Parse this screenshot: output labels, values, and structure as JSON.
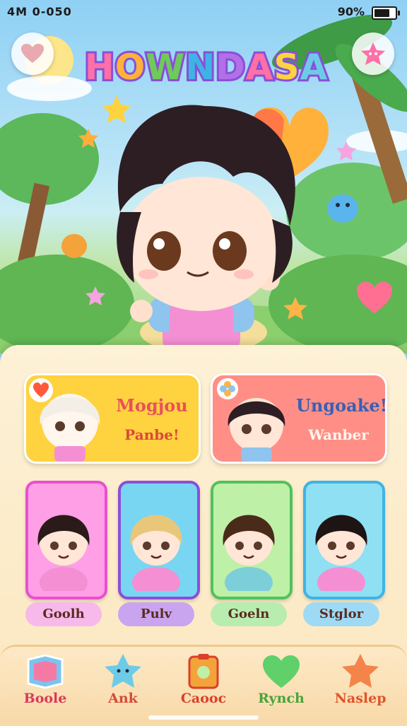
{
  "status": {
    "time": "4M 0-050",
    "battery_text": "90%",
    "battery_level": 0.8
  },
  "header": {
    "title": "HOWNDASA",
    "left_icon": "heart-icon",
    "right_icon": "star-mascot-icon"
  },
  "featured": [
    {
      "line1": "Mogjou",
      "line2": "Panbe!",
      "color": "#ffd23f",
      "badge_icon": "heart-icon"
    },
    {
      "line1": "Ungoake!",
      "line2": "Wanber",
      "color": "#ff8f86",
      "badge_icon": "flower-icon"
    }
  ],
  "characters": [
    {
      "name": "Goolh",
      "frame": "#e94fd0",
      "bg": "#ff9fe6",
      "pill": "#f7b8ea",
      "hair": "#2b1a1a"
    },
    {
      "name": "Pulv",
      "frame": "#8a4fd8",
      "bg": "#79d6f2",
      "pill": "#c9a5f0",
      "hair": "#e8c77a"
    },
    {
      "name": "Goeln",
      "frame": "#4fc35a",
      "bg": "#bff0a8",
      "pill": "#b9edb0",
      "hair": "#4a2b1a"
    },
    {
      "name": "Stglor",
      "frame": "#3fb3e6",
      "bg": "#8fe0f2",
      "pill": "#9fdaf5",
      "hair": "#1e1414"
    }
  ],
  "nav": [
    {
      "label": "Boole",
      "icon": "book-icon",
      "color": "#d93a5a"
    },
    {
      "label": "Ank",
      "icon": "star-icon",
      "color": "#d44a3a"
    },
    {
      "label": "Caooc",
      "icon": "clipboard-icon",
      "color": "#d9412a"
    },
    {
      "label": "Rynch",
      "icon": "heart-icon",
      "color": "#4aa33a"
    },
    {
      "label": "Naslep",
      "icon": "star-icon",
      "color": "#e0542a"
    }
  ]
}
